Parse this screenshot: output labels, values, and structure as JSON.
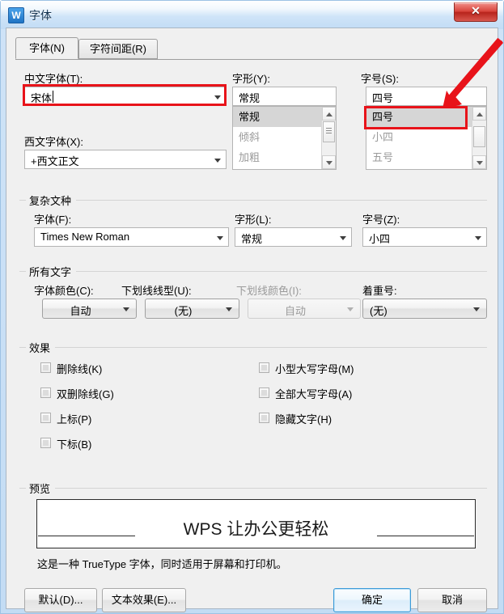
{
  "window": {
    "title": "字体",
    "app_icon": "wps-icon",
    "close_label": "✕"
  },
  "tabs": [
    {
      "label": "字体(N)",
      "active": true
    },
    {
      "label": "字符间距(R)",
      "active": false
    }
  ],
  "latin_section": {
    "chinese_font": {
      "label": "中文字体(T):",
      "value": "宋体"
    },
    "western_font": {
      "label": "西文字体(X):",
      "value": "+西文正文"
    },
    "style": {
      "label": "字形(Y):",
      "value": "常规",
      "options": [
        "常规",
        "倾斜",
        "加粗"
      ],
      "selected_index": 0
    },
    "size": {
      "label": "字号(S):",
      "value": "四号",
      "options": [
        "四号",
        "小四",
        "五号"
      ],
      "selected_index": 0
    }
  },
  "complex_script": {
    "group_title": "复杂文种",
    "font": {
      "label": "字体(F):",
      "value": "Times New Roman"
    },
    "style": {
      "label": "字形(L):",
      "value": "常规"
    },
    "size": {
      "label": "字号(Z):",
      "value": "小四"
    }
  },
  "all_text": {
    "group_title": "所有文字",
    "font_color": {
      "label": "字体颜色(C):",
      "value": "自动",
      "disabled": false
    },
    "underline_style": {
      "label": "下划线线型(U):",
      "value": "(无)",
      "disabled": false
    },
    "underline_color": {
      "label": "下划线颜色(I):",
      "value": "自动",
      "disabled": true
    },
    "emphasis_mark": {
      "label": "着重号:",
      "value": "(无)",
      "disabled": false
    }
  },
  "effects": {
    "group_title": "效果",
    "left_column": [
      {
        "label": "删除线(K)",
        "checked": false
      },
      {
        "label": "双删除线(G)",
        "checked": false
      },
      {
        "label": "上标(P)",
        "checked": false
      },
      {
        "label": "下标(B)",
        "checked": false
      }
    ],
    "right_column": [
      {
        "label": "小型大写字母(M)",
        "checked": false
      },
      {
        "label": "全部大写字母(A)",
        "checked": false
      },
      {
        "label": "隐藏文字(H)",
        "checked": false
      }
    ]
  },
  "preview": {
    "group_title": "预览",
    "sample_text": "WPS 让办公更轻松",
    "note": "这是一种 TrueType 字体，同时适用于屏幕和打印机。"
  },
  "footer": {
    "default_button": "默认(D)...",
    "text_effects_button": "文本效果(E)...",
    "ok_button": "确定",
    "cancel_button": "取消"
  },
  "annotations": {
    "accent_color": "#e8131a",
    "highlight_chinese_font": true,
    "highlight_size_item": true,
    "arrow_points_to": "四号"
  }
}
